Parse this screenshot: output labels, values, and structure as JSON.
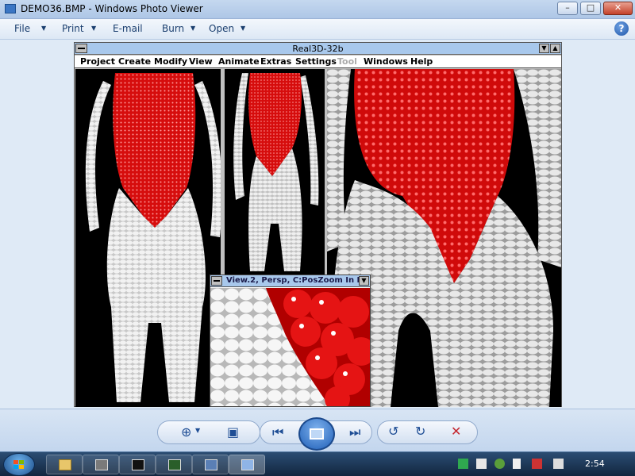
{
  "window": {
    "title": "DEMO36.BMP - Windows Photo Viewer",
    "minimize": "–",
    "maximize": "□",
    "close": "✕"
  },
  "menu": {
    "file": "File",
    "print": "Print",
    "email": "E-mail",
    "burn": "Burn",
    "open": "Open",
    "help": "?"
  },
  "inner_app": {
    "title": "Real3D-32b",
    "menus": [
      "Project",
      "Create",
      "Modify",
      "View",
      "Animate",
      "Extras",
      "Settings",
      "Tool",
      "Windows",
      "Help"
    ],
    "disabled_menu": "Tool",
    "sub_window_title": "View.2, Persp, C:PosZoom In N:"
  },
  "taskbar": {
    "clock": "2:54"
  },
  "colors": {
    "accent": "#1f5fb7",
    "render_red": "#e01010",
    "render_white": "#e8e8e8"
  }
}
